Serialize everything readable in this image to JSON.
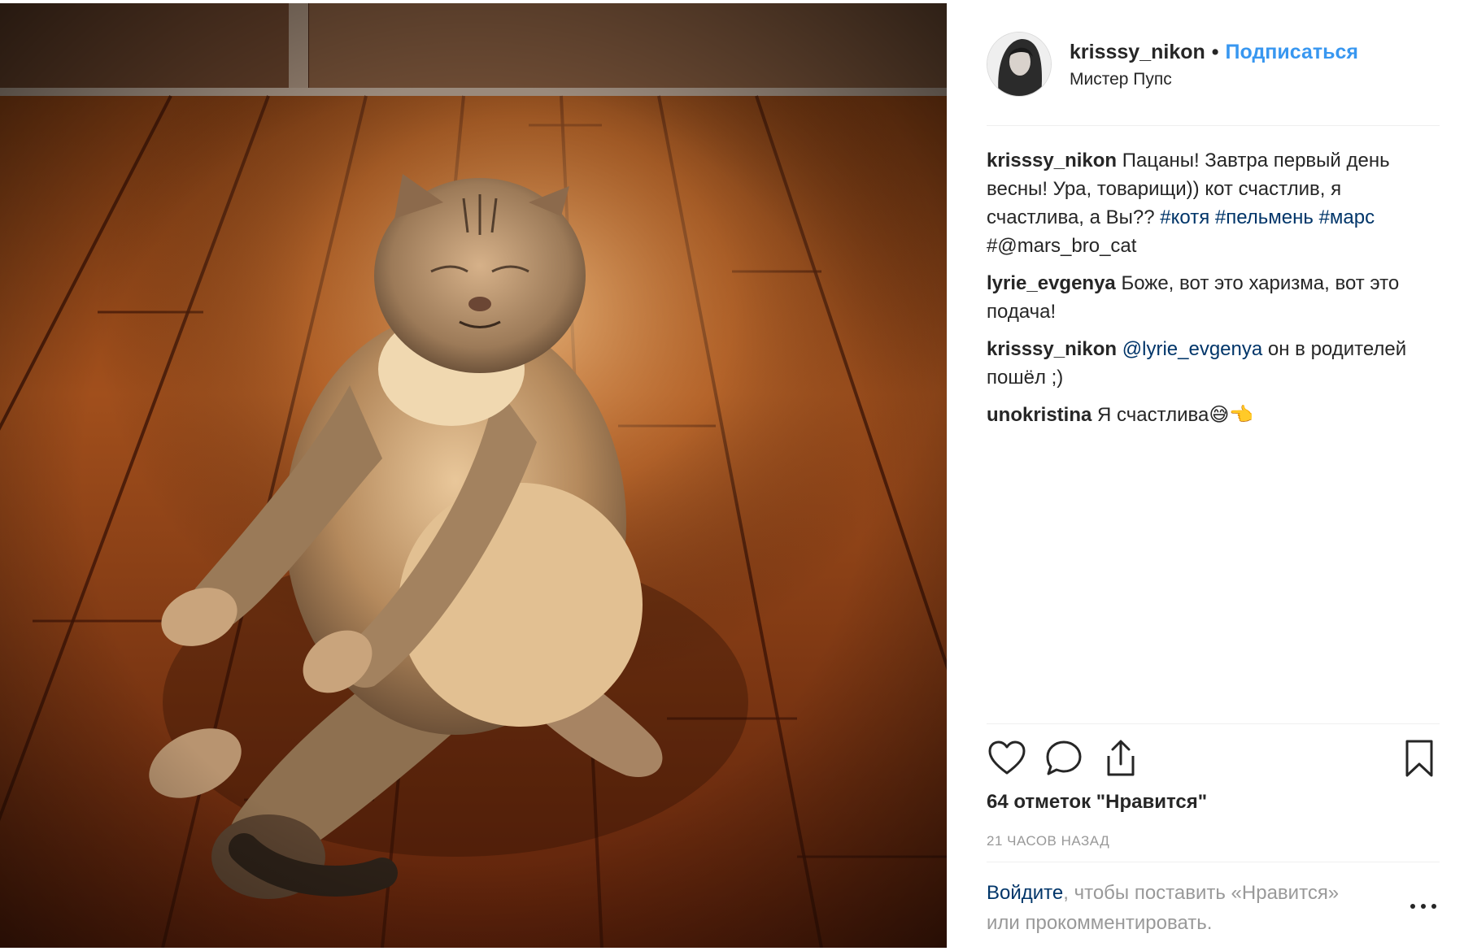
{
  "post": {
    "photo_alt": "cat lying on wooden floor",
    "header": {
      "username": "krisssy_nikon",
      "separator": "•",
      "follow_label": "Подписаться",
      "location": "Мистер Пупс"
    },
    "caption": {
      "username": "krisssy_nikon",
      "text": "Пацаны! Завтра первый день весны! Ура, товарищи)) кот счастлив, я счастлива, а Вы??",
      "hashtags": [
        "#котя",
        "#пельмень",
        "#марс"
      ],
      "tail": "#@mars_bro_cat"
    },
    "comments": [
      {
        "username": "lyrie_evgenya",
        "mention": "",
        "text": "Боже, вот это харизма, вот это подача!"
      },
      {
        "username": "krisssy_nikon",
        "mention": "@lyrie_evgenya",
        "text": "он в родителей пошёл ;)"
      },
      {
        "username": "unokristina",
        "mention": "",
        "text": "Я счастлива😅👈"
      }
    ],
    "likes_label": "64 отметок \"Нравится\"",
    "time_label": "21 ЧАСОВ НАЗАД",
    "login_link": "Войдите",
    "login_rest": ", чтобы поставить «Нравится» или прокомментировать.",
    "icons": {
      "like": "heart-icon",
      "comment": "comment-icon",
      "share": "share-icon",
      "save": "bookmark-icon",
      "more": "more-icon"
    },
    "colors": {
      "accent": "#3897f0",
      "link": "#003569",
      "text": "#262626",
      "muted": "#999999"
    }
  }
}
